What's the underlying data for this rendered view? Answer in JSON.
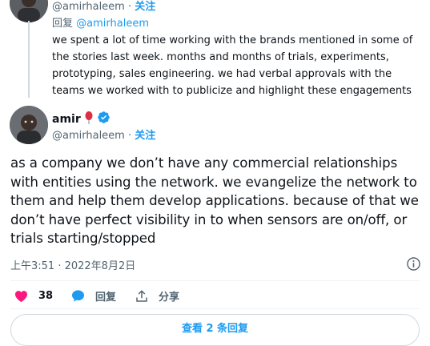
{
  "reply_tweet": {
    "handle": "@amirhaleem",
    "dot": "·",
    "follow": "关注",
    "reply_to_prefix": "回复",
    "reply_to_handle": "@amirhaleem",
    "text": "we spent a lot of time working with the brands mentioned in some of the stories last week. months and months of trials, experiments, prototyping, sales engineering. we had verbal approvals with the teams we worked with to publicize and highlight these engagements"
  },
  "main_tweet": {
    "name": "amir",
    "handle": "@amirhaleem",
    "dot": "·",
    "follow": "关注",
    "text": "as a company we don’t have any commercial relationships with entities using the network. we evangelize the network to them and help them develop applications. because of that we don’t have perfect visibility in to when sensors are on/off, or trials starting/stopped",
    "timestamp": "上午3:51 · 2022年8月2日"
  },
  "actions": {
    "like_count": "38",
    "reply_label": "回复",
    "share_label": "分享"
  },
  "bottom_button": "查看 2 条回复",
  "colors": {
    "accent": "#1d9bf0",
    "like": "#f91880",
    "text": "#0f1419",
    "muted": "#536471"
  }
}
